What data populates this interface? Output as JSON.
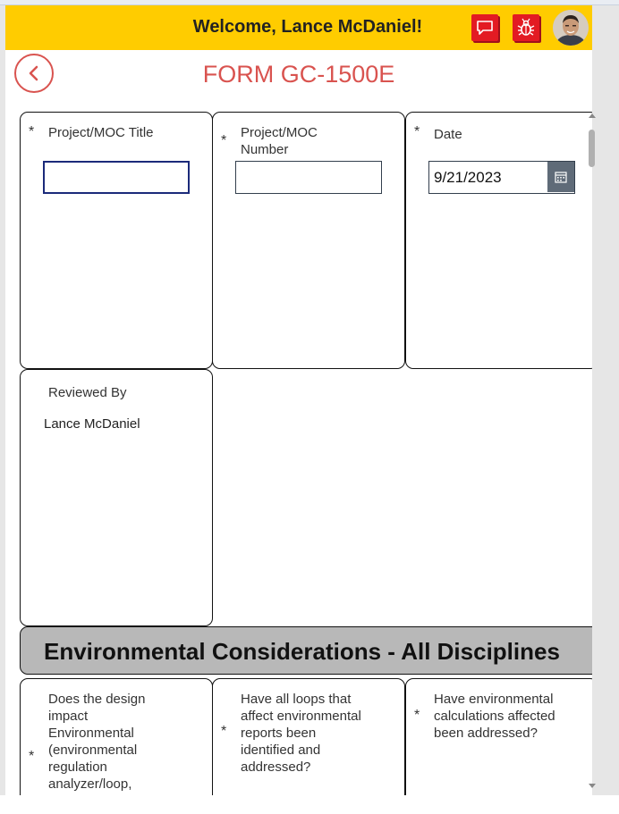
{
  "header": {
    "welcome": "Welcome, Lance McDaniel!",
    "feedback_icon": "chat-bubble-icon",
    "bug_icon": "bug-icon",
    "brand_color": "#ffcc00",
    "button_color": "#e31b23"
  },
  "page": {
    "title": "FORM GC-1500E",
    "title_color": "#d9534f",
    "back_icon": "chevron-left-icon"
  },
  "fields": {
    "project_title": {
      "required": "*",
      "label": "Project/MOC Title",
      "value": ""
    },
    "project_number": {
      "required": "*",
      "label": "Project/MOC\nNumber",
      "value": ""
    },
    "date": {
      "required": "*",
      "label": "Date",
      "value": "9/21/2023",
      "icon": "calendar-icon"
    },
    "reviewed_by": {
      "label": "Reviewed By",
      "value": "Lance McDaniel"
    }
  },
  "section": {
    "title": "Environmental Considerations - All Disciplines"
  },
  "questions": [
    {
      "required": "*",
      "label": "Does the design\nimpact\nEnvironmental\n(environmental\nregulation\nanalyzer/loop,\nreports and/or"
    },
    {
      "required": "*",
      "label": "Have all loops that\naffect environmental\nreports been\nidentified and\naddressed?"
    },
    {
      "required": "*",
      "label": "Have environmental\ncalculations affected\nbeen addressed?"
    }
  ]
}
